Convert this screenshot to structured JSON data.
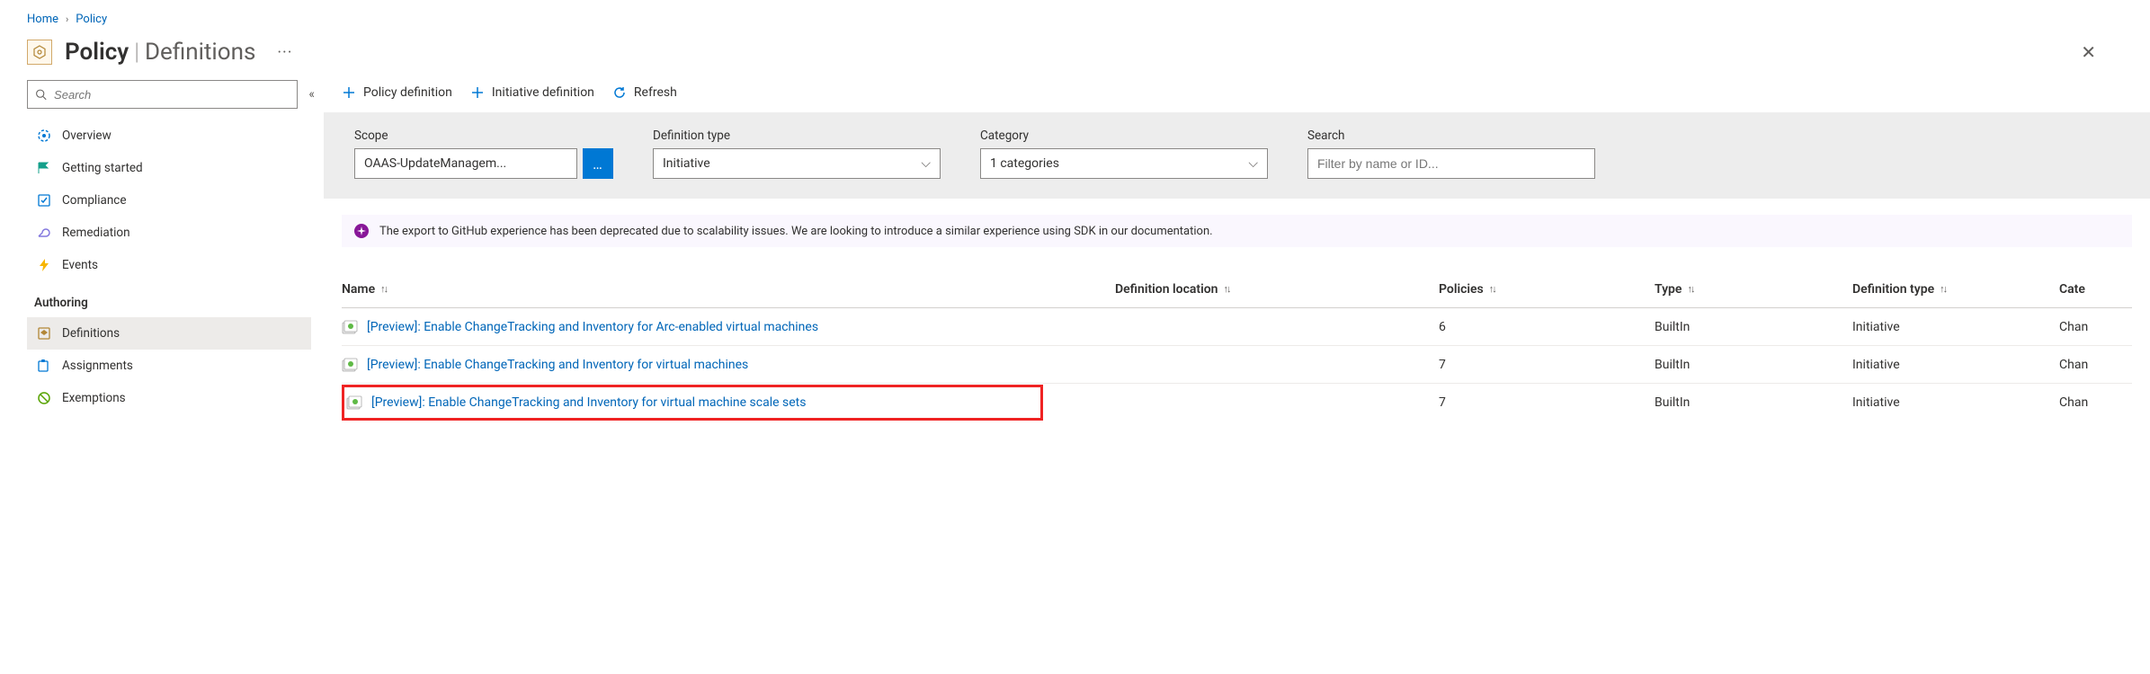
{
  "breadcrumb": {
    "home": "Home",
    "policy": "Policy"
  },
  "title": {
    "main": "Policy",
    "sub": "Definitions"
  },
  "close_aria": "Close",
  "sidebar": {
    "search_placeholder": "Search",
    "items_general": [
      {
        "label": "Overview",
        "icon": "dashboard-icon"
      },
      {
        "label": "Getting started",
        "icon": "flag-icon"
      },
      {
        "label": "Compliance",
        "icon": "checklist-icon"
      },
      {
        "label": "Remediation",
        "icon": "wrench-icon"
      },
      {
        "label": "Events",
        "icon": "bolt-icon"
      }
    ],
    "authoring_title": "Authoring",
    "items_authoring": [
      {
        "label": "Definitions",
        "icon": "definition-icon",
        "selected": true
      },
      {
        "label": "Assignments",
        "icon": "assignment-icon"
      },
      {
        "label": "Exemptions",
        "icon": "exemption-icon"
      }
    ]
  },
  "toolbar": {
    "policy_definition": "Policy definition",
    "initiative_definition": "Initiative definition",
    "refresh": "Refresh"
  },
  "filters": {
    "scope_label": "Scope",
    "scope_value": "OAAS-UpdateManagem...",
    "definition_type_label": "Definition type",
    "definition_type_value": "Initiative",
    "category_label": "Category",
    "category_value": "1 categories",
    "search_label": "Search",
    "search_placeholder": "Filter by name or ID..."
  },
  "banner": {
    "text": "The export to GitHub experience has been deprecated due to scalability issues. We are looking to introduce a similar experience using SDK in our documentation."
  },
  "table": {
    "headers": {
      "name": "Name",
      "definition_location": "Definition location",
      "policies": "Policies",
      "type": "Type",
      "definition_type": "Definition type",
      "category": "Cate"
    },
    "rows": [
      {
        "name": "[Preview]: Enable ChangeTracking and Inventory for Arc-enabled virtual machines",
        "location": "",
        "policies": "6",
        "type": "BuiltIn",
        "definition_type": "Initiative",
        "category": "Chan",
        "highlighted": false
      },
      {
        "name": "[Preview]: Enable ChangeTracking and Inventory for virtual machines",
        "location": "",
        "policies": "7",
        "type": "BuiltIn",
        "definition_type": "Initiative",
        "category": "Chan",
        "highlighted": false
      },
      {
        "name": "[Preview]: Enable ChangeTracking and Inventory for virtual machine scale sets",
        "location": "",
        "policies": "7",
        "type": "BuiltIn",
        "definition_type": "Initiative",
        "category": "Chan",
        "highlighted": true
      }
    ]
  }
}
